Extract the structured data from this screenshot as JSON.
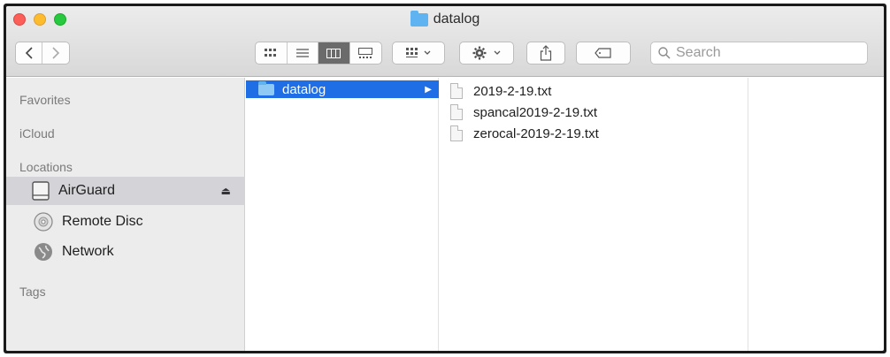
{
  "window": {
    "title": "datalog"
  },
  "toolbar": {
    "search_placeholder": "Search",
    "icons": [
      "back-arrow",
      "forward-arrow",
      "icon-view",
      "list-view",
      "column-view",
      "gallery-view",
      "group-by",
      "action-gear",
      "share",
      "tags"
    ]
  },
  "sidebar": {
    "favorites": "Favorites",
    "icloud": "iCloud",
    "locations": "Locations",
    "items": [
      {
        "label": "AirGuard",
        "eject": "⏏"
      },
      {
        "label": "Remote Disc"
      },
      {
        "label": "Network"
      }
    ],
    "tags": "Tags"
  },
  "column1": {
    "items": [
      {
        "label": "datalog",
        "arrow": "▶"
      }
    ]
  },
  "column2": {
    "files": [
      "2019-2-19.txt",
      "spancal2019-2-19.txt",
      "zerocal-2019-2-19.txt"
    ]
  },
  "colors": {
    "selection": "#1f6ee6",
    "sidebar_selected": "#d3d3d8",
    "folder": "#5fb3f0"
  }
}
